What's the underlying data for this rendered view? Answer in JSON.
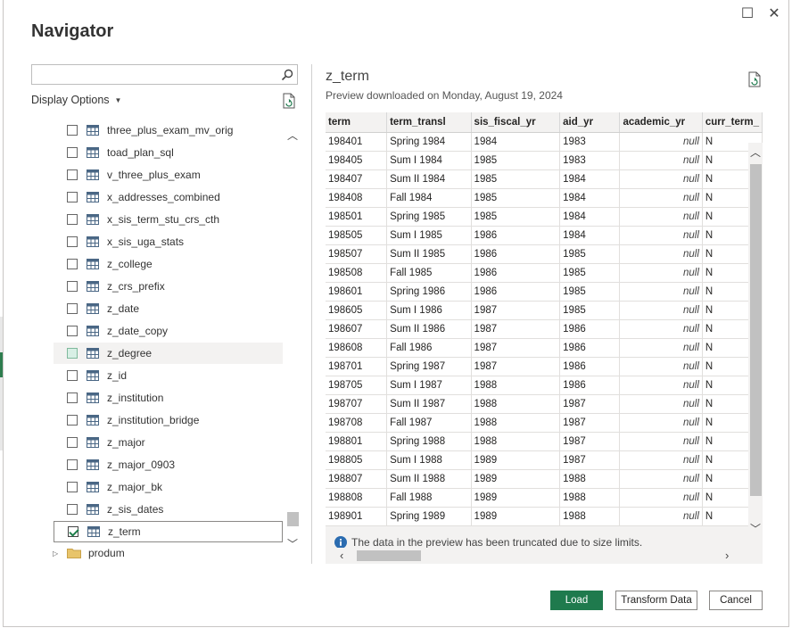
{
  "window": {
    "title": "Navigator",
    "maximize_glyph": "☐",
    "close_glyph": "✕"
  },
  "left": {
    "search": {
      "value": "",
      "placeholder": "",
      "icon": "search-icon"
    },
    "display_options": "Display Options",
    "tree_items": [
      {
        "label": "three_plus_exam_mv_orig",
        "checked": false,
        "state": ""
      },
      {
        "label": "toad_plan_sql",
        "checked": false,
        "state": ""
      },
      {
        "label": "v_three_plus_exam",
        "checked": false,
        "state": ""
      },
      {
        "label": "x_addresses_combined",
        "checked": false,
        "state": ""
      },
      {
        "label": "x_sis_term_stu_crs_cth",
        "checked": false,
        "state": ""
      },
      {
        "label": "x_sis_uga_stats",
        "checked": false,
        "state": ""
      },
      {
        "label": "z_college",
        "checked": false,
        "state": ""
      },
      {
        "label": "z_crs_prefix",
        "checked": false,
        "state": ""
      },
      {
        "label": "z_date",
        "checked": false,
        "state": ""
      },
      {
        "label": "z_date_copy",
        "checked": false,
        "state": ""
      },
      {
        "label": "z_degree",
        "checked": false,
        "state": "hover"
      },
      {
        "label": "z_id",
        "checked": false,
        "state": ""
      },
      {
        "label": "z_institution",
        "checked": false,
        "state": ""
      },
      {
        "label": "z_institution_bridge",
        "checked": false,
        "state": ""
      },
      {
        "label": "z_major",
        "checked": false,
        "state": ""
      },
      {
        "label": "z_major_0903",
        "checked": false,
        "state": ""
      },
      {
        "label": "z_major_bk",
        "checked": false,
        "state": ""
      },
      {
        "label": "z_sis_dates",
        "checked": false,
        "state": ""
      },
      {
        "label": "z_term",
        "checked": true,
        "state": "selected"
      }
    ],
    "folder": {
      "label": "produm"
    }
  },
  "preview": {
    "title": "z_term",
    "subtitle": "Preview downloaded on Monday, August 19, 2024",
    "columns": [
      "term",
      "term_transl",
      "sis_fiscal_yr",
      "aid_yr",
      "academic_yr",
      "curr_term_"
    ],
    "rows": [
      [
        "198401",
        "Spring 1984",
        "1984",
        "1983",
        "null",
        "N"
      ],
      [
        "198405",
        "Sum I 1984",
        "1985",
        "1983",
        "null",
        "N"
      ],
      [
        "198407",
        "Sum II 1984",
        "1985",
        "1984",
        "null",
        "N"
      ],
      [
        "198408",
        "Fall 1984",
        "1985",
        "1984",
        "null",
        "N"
      ],
      [
        "198501",
        "Spring 1985",
        "1985",
        "1984",
        "null",
        "N"
      ],
      [
        "198505",
        "Sum I 1985",
        "1986",
        "1984",
        "null",
        "N"
      ],
      [
        "198507",
        "Sum II 1985",
        "1986",
        "1985",
        "null",
        "N"
      ],
      [
        "198508",
        "Fall 1985",
        "1986",
        "1985",
        "null",
        "N"
      ],
      [
        "198601",
        "Spring 1986",
        "1986",
        "1985",
        "null",
        "N"
      ],
      [
        "198605",
        "Sum I 1986",
        "1987",
        "1985",
        "null",
        "N"
      ],
      [
        "198607",
        "Sum II 1986",
        "1987",
        "1986",
        "null",
        "N"
      ],
      [
        "198608",
        "Fall 1986",
        "1987",
        "1986",
        "null",
        "N"
      ],
      [
        "198701",
        "Spring 1987",
        "1987",
        "1986",
        "null",
        "N"
      ],
      [
        "198705",
        "Sum I 1987",
        "1988",
        "1986",
        "null",
        "N"
      ],
      [
        "198707",
        "Sum II 1987",
        "1988",
        "1987",
        "null",
        "N"
      ],
      [
        "198708",
        "Fall 1987",
        "1988",
        "1987",
        "null",
        "N"
      ],
      [
        "198801",
        "Spring 1988",
        "1988",
        "1987",
        "null",
        "N"
      ],
      [
        "198805",
        "Sum I 1988",
        "1989",
        "1987",
        "null",
        "N"
      ],
      [
        "198807",
        "Sum II 1988",
        "1989",
        "1988",
        "null",
        "N"
      ],
      [
        "198808",
        "Fall 1988",
        "1989",
        "1988",
        "null",
        "N"
      ],
      [
        "198901",
        "Spring 1989",
        "1989",
        "1988",
        "null",
        "N"
      ]
    ],
    "truncation_note": "The data in the preview has been truncated due to size limits."
  },
  "footer": {
    "load": "Load",
    "transform": "Transform Data",
    "cancel": "Cancel"
  },
  "colors": {
    "accent": "#1f7a4d",
    "checkmark": "#1e7e4a",
    "info": "#2b6cb0"
  }
}
